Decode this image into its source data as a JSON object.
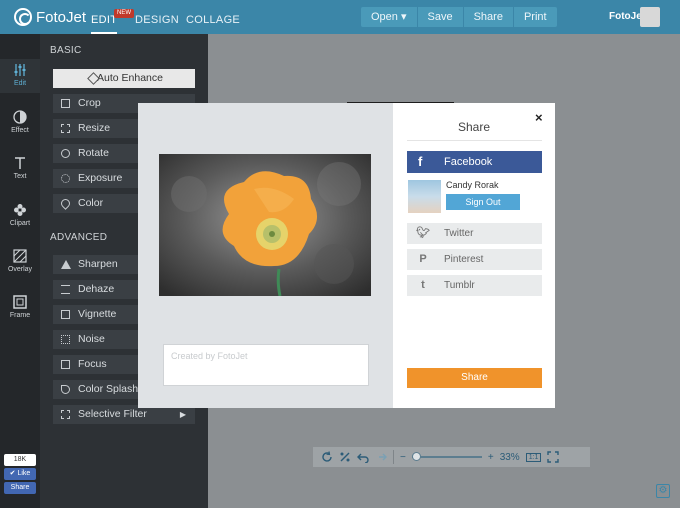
{
  "header": {
    "logo_text": "FotoJet",
    "nav": [
      {
        "label": "EDIT",
        "active": true,
        "badge": "NEW"
      },
      {
        "label": "DESIGN",
        "active": false
      },
      {
        "label": "COLLAGE",
        "active": false
      }
    ],
    "actions": {
      "open": "Open ▾",
      "save": "Save",
      "share": "Share",
      "print": "Print"
    },
    "username": "FotoJet"
  },
  "rail": [
    {
      "label": "Edit",
      "icon": "sliders-icon",
      "active": true
    },
    {
      "label": "Effect",
      "icon": "contrast-icon"
    },
    {
      "label": "Text",
      "icon": "text-icon"
    },
    {
      "label": "Clipart",
      "icon": "flower-icon"
    },
    {
      "label": "Overlay",
      "icon": "hatch-icon"
    },
    {
      "label": "Frame",
      "icon": "frame-icon"
    }
  ],
  "panel": {
    "basic_label": "BASIC",
    "advanced_label": "ADVANCED",
    "basic": [
      "Auto Enhance",
      "Crop",
      "Resize",
      "Rotate",
      "Exposure",
      "Color"
    ],
    "advanced": [
      "Sharpen",
      "Dehaze",
      "Vignette",
      "Noise",
      "Focus",
      "Color Splash",
      "Selective Filter"
    ]
  },
  "bottom_bar": {
    "zoom": "33%",
    "minus": "−",
    "plus": "+",
    "fit": "1:1"
  },
  "like_widget": {
    "count": "18K",
    "like": "✔ Like",
    "share": "Share"
  },
  "modal": {
    "title": "Share",
    "close": "×",
    "facebook_label": "Facebook",
    "fb_user": "Candy Rorak",
    "sign_out": "Sign Out",
    "twitter": "Twitter",
    "pinterest": "Pinterest",
    "tumblr": "Tumblr",
    "caption_placeholder": "Created by FotoJet",
    "share_button": "Share"
  },
  "colors": {
    "header": "#3b86a8",
    "facebook": "#3b5998",
    "share": "#f0932b",
    "signout": "#52a6d6",
    "flower": "#f2a23a"
  }
}
